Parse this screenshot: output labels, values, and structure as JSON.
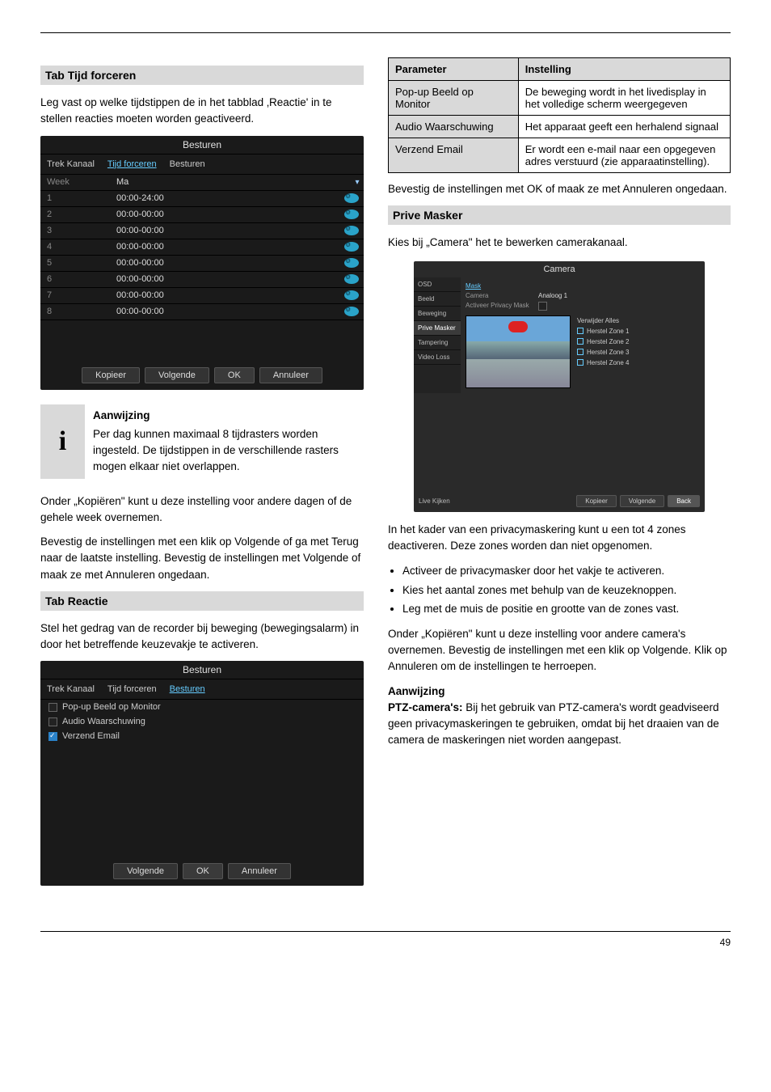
{
  "leftColumn": {
    "introHeading": "Tab Tijd forceren",
    "introText": "Leg vast op welke tijdstippen de in het tabblad ‚Reactie' in te stellen reacties moeten worden geactiveerd.",
    "schedDialog": {
      "title": "Besturen",
      "tabs": [
        "Trek Kanaal",
        "Tijd forceren",
        "Besturen"
      ],
      "activeTab": 1,
      "weekLabel": "Week",
      "weekValue": "Ma",
      "rows": [
        {
          "n": "1",
          "time": "00:00-24:00"
        },
        {
          "n": "2",
          "time": "00:00-00:00"
        },
        {
          "n": "3",
          "time": "00:00-00:00"
        },
        {
          "n": "4",
          "time": "00:00-00:00"
        },
        {
          "n": "5",
          "time": "00:00-00:00"
        },
        {
          "n": "6",
          "time": "00:00-00:00"
        },
        {
          "n": "7",
          "time": "00:00-00:00"
        },
        {
          "n": "8",
          "time": "00:00-00:00"
        }
      ],
      "buttons": [
        "Kopieer",
        "Volgende",
        "OK",
        "Annuleer"
      ]
    },
    "infoBox": {
      "icon": "i",
      "title": "Aanwijzing",
      "text": "Per dag kunnen maximaal 8 tijdrasters worden ingesteld. De tijdstippen in de verschillende rasters mogen elkaar niet overlappen."
    },
    "copyNote": "Onder „Kopiëren\" kunt u deze instelling voor andere dagen of de gehele week overnemen.",
    "confirmNote": "Bevestig de instellingen met een klik op Volgende of ga met Terug naar de laatste instelling. Bevestig de instellingen met Volgende of maak ze met Annuleren ongedaan.",
    "tabReactionHeading": "Tab Reactie",
    "tabReactionText": "Stel het gedrag van de recorder bij beweging (bewegingsalarm) in door het betreffende keuzevakje te activeren.",
    "reactionDialog": {
      "title": "Besturen",
      "tabs": [
        "Trek Kanaal",
        "Tijd forceren",
        "Besturen"
      ],
      "activeTab": 2,
      "checks": [
        {
          "label": "Pop-up Beeld op Monitor",
          "checked": false,
          "blue": false
        },
        {
          "label": "Audio Waarschuwing",
          "checked": false,
          "blue": false
        },
        {
          "label": "Verzend Email",
          "checked": true,
          "blue": true
        }
      ],
      "buttons": [
        "Volgende",
        "OK",
        "Annuleer"
      ]
    }
  },
  "rightColumn": {
    "paramTable": {
      "cols": [
        "Parameter",
        "Instelling"
      ],
      "rows": [
        {
          "key": "Pop-up Beeld op Monitor",
          "val": "De beweging wordt in het livedisplay in het volledige scherm weergegeven"
        },
        {
          "key": "Audio Waarschuwing",
          "val": "Het apparaat geeft een herhalend signaal"
        },
        {
          "key": "Verzend Email",
          "val": "Er wordt een e-mail naar een opgegeven adres verstuurd (zie apparaatinstelling)."
        }
      ]
    },
    "confirmNote2": "Bevestig de instellingen met OK of maak ze met Annuleren ongedaan.",
    "privacyHeading": "Prive Masker",
    "privacyIntro": "Kies bij „Camera\" het te bewerken camerakanaal.",
    "camDialog": {
      "title": "Camera",
      "sidebar": [
        "OSD",
        "Beeld",
        "Beweging",
        "Prive Masker",
        "Tampering",
        "Video Loss"
      ],
      "activeSidebar": 3,
      "maskLabel": "Mask",
      "cameraLabel": "Camera",
      "cameraValue": "Analoog 1",
      "enableLabel": "Activeer Privacy Mask",
      "zonesHeader": "Verwijder Alles",
      "zones": [
        "Herstel Zone 1",
        "Herstel Zone 2",
        "Herstel Zone 3",
        "Herstel Zone 4"
      ],
      "liveLabel": "Live Kijken",
      "buttons": [
        "Kopieer",
        "Volgende",
        "Back"
      ]
    },
    "belowText1": "In het kader van een privacymaskering kunt u een tot 4 zones deactiveren. Deze zones worden dan niet opgenomen.",
    "belowSteps": [
      "Activeer de privacymasker door het vakje te activeren.",
      "Kies het aantal zones met behulp van de keuzeknoppen.",
      "Leg met de muis de positie en grootte van de zones vast."
    ],
    "belowText2": "Onder „Kopiëren\" kunt u deze instelling voor andere camera's overnemen. Bevestig de instellingen met een klik op Volgende. Klik op Annuleren om de instellingen te herroepen.",
    "noteHeading": "Aanwijzing",
    "noteLabel": "PTZ-camera's:",
    "noteText": "Bij het gebruik van PTZ-camera's wordt geadviseerd geen privacymaskeringen te gebruiken, omdat bij het draaien van de camera de maskeringen niet worden aangepast."
  },
  "footer": "49"
}
